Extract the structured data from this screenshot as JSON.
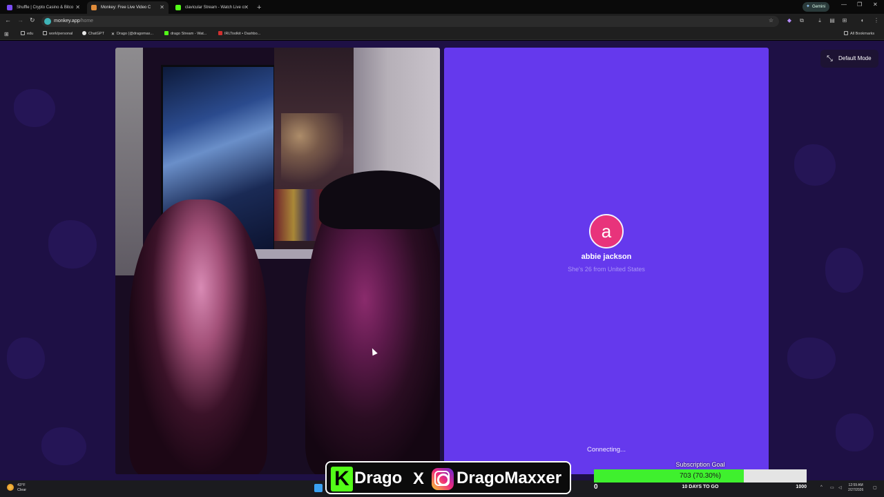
{
  "browser": {
    "tabs": [
      {
        "title": "Shuffle | Crypto Casino & Bitco",
        "color": "#7b4df5"
      },
      {
        "title": "Monkey: Free Live Video C",
        "color": "#e08c3a"
      },
      {
        "title": "clavicular Stream - Watch Live o",
        "color": "#53fc18"
      }
    ],
    "new_tab": "+",
    "gemini": "Gemini",
    "url_host": "monkey.app",
    "url_path": "/home",
    "bookmarks": [
      {
        "label": "edu",
        "color": "#bdbdbd"
      },
      {
        "label": "work/personal",
        "color": "#bdbdbd"
      },
      {
        "label": "ChatGPT",
        "color": "#e8e8e8"
      },
      {
        "label": "Drago (@dragomax...",
        "color": "#111111"
      },
      {
        "label": "drago Stream - Wat...",
        "color": "#53fc18"
      },
      {
        "label": "IRLToolkit • Dashbo...",
        "color": "#d0302f"
      }
    ],
    "all_bookmarks": "All Bookmarks"
  },
  "app": {
    "mode_button": "Default Mode",
    "match": {
      "initial": "a",
      "name": "abbie jackson",
      "info": "She's 26 from United States",
      "status": "Connecting..."
    }
  },
  "overlay": {
    "brand_left": "Drago",
    "brand_right": "DragoMaxxer",
    "goal": {
      "title": "Subscription Goal",
      "text": "703 (70.30%)",
      "fraction": 0.703,
      "min": "0",
      "max": "1000",
      "days": "10 DAYS TO GO"
    }
  },
  "taskbar": {
    "temp": "43°F",
    "condition": "Clear",
    "time": "12:59 AM",
    "date": "2/27/2026"
  }
}
